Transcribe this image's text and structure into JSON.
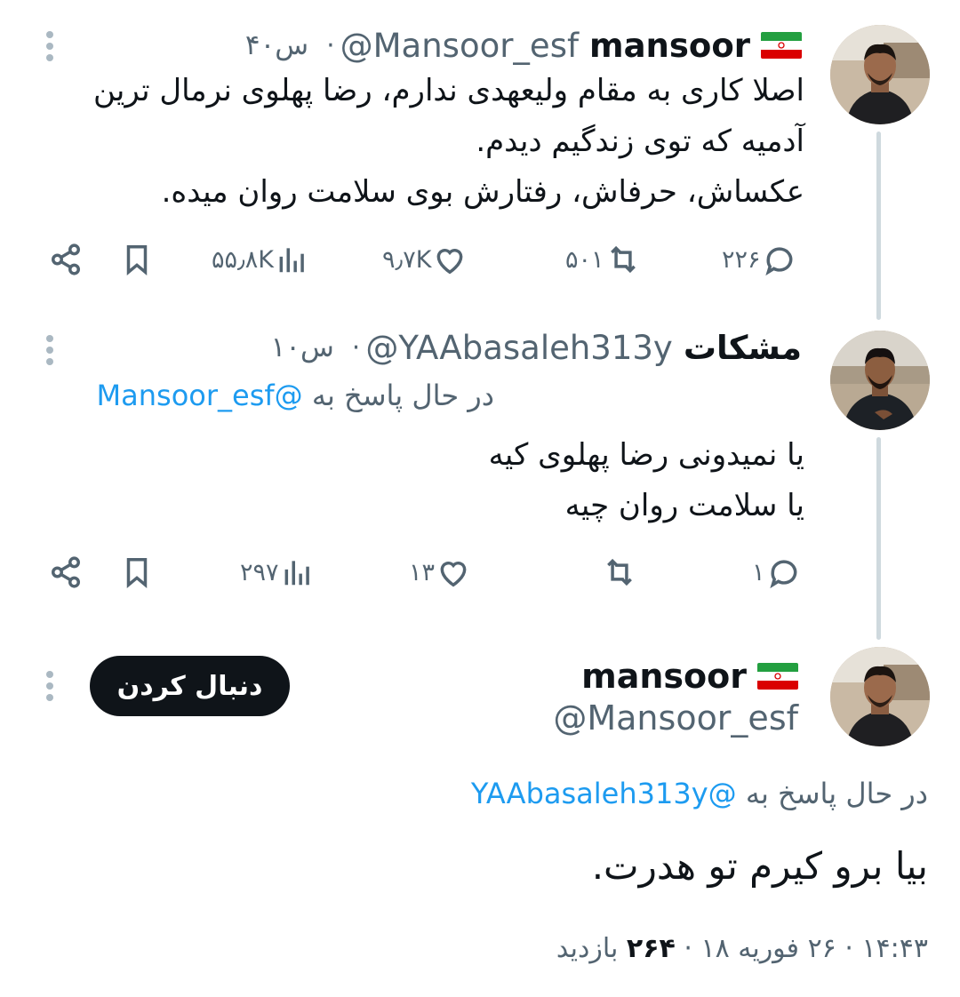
{
  "tweet1": {
    "display_name": "mansoor",
    "handle": "@Mansoor_esf",
    "time": "۴۰س",
    "lines": [
      "اصلا کاری به مقام ولیعهدی ندارم، رضا پهلوی نرمال ترین",
      "آدمیه که توی زندگیم دیدم.",
      "عکساش، حرفاش، رفتارش بوی سلامت روان میده."
    ],
    "replies": "۲۲۶",
    "reposts": "۵۰۱",
    "likes": "۹٫۷K",
    "views": "۵۵٫۸K"
  },
  "tweet2": {
    "display_name": "مشکات",
    "handle": "@YAAbasaleh313y",
    "time": "۱۰س",
    "reply_prefix": "در حال پاسخ به",
    "reply_to": "@Mansoor_esf",
    "lines": [
      "یا نمیدونی رضا پهلوی کیه",
      "یا سلامت روان چیه"
    ],
    "replies": "۱",
    "reposts": "",
    "likes": "۱۳",
    "views": "۲۹۷"
  },
  "main_tweet": {
    "display_name": "mansoor",
    "handle": "@Mansoor_esf",
    "follow_label": "دنبال کردن",
    "reply_prefix": "در حال پاسخ به",
    "reply_to": "@YAAbasaleh313y",
    "text": "بیا برو کیرم تو هدرت.",
    "time": "۱۴:۴۳",
    "date": "۲۶ فوریه ۱۸",
    "views_count": "۲۶۴",
    "views_label": "بازدید"
  },
  "colors": {
    "accent": "#1d9bf0",
    "muted": "#536471",
    "text": "#0f1419",
    "thread_line": "#cfd9de"
  }
}
